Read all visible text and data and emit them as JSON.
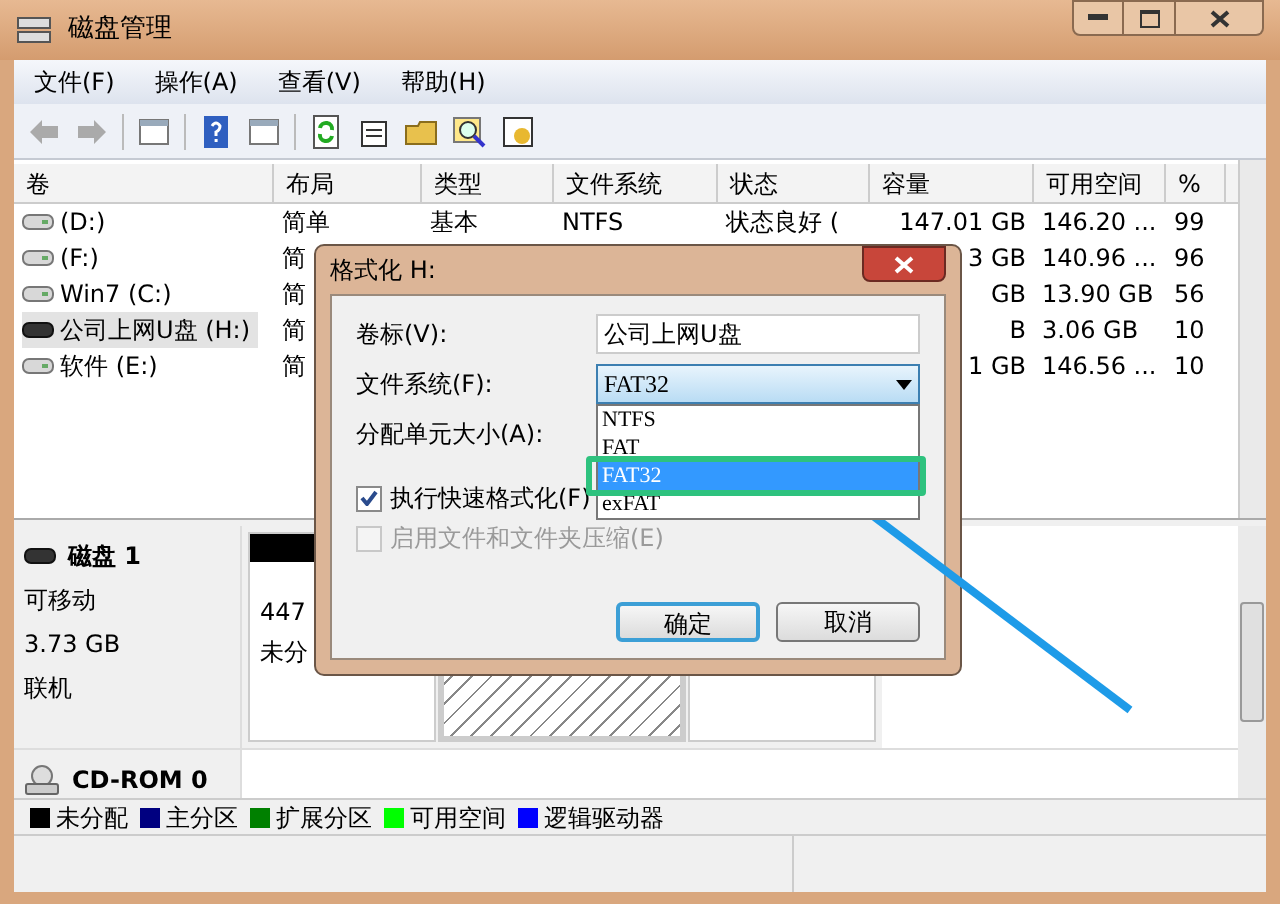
{
  "window": {
    "title": "磁盘管理"
  },
  "menu": [
    "文件(F)",
    "操作(A)",
    "查看(V)",
    "帮助(H)"
  ],
  "table": {
    "columns": [
      "卷",
      "布局",
      "类型",
      "文件系统",
      "状态",
      "容量",
      "可用空间",
      "%"
    ],
    "rows": [
      {
        "kind": "disk",
        "name": "(D:)",
        "layout": "简单",
        "type": "基本",
        "fs": "NTFS",
        "status": "状态良好 (",
        "capacity": "147.01 GB",
        "free": "146.20 ...",
        "pct": "99",
        "selected": false
      },
      {
        "kind": "disk",
        "name": "(F:)",
        "layout": "简",
        "capacity": "3 GB",
        "free": "140.96 ...",
        "pct": "96",
        "selected": false
      },
      {
        "kind": "disk",
        "name": "Win7 (C:)",
        "layout": "简",
        "capacity": "GB",
        "free": "13.90 GB",
        "pct": "56",
        "selected": false
      },
      {
        "kind": "removable",
        "name": "公司上网U盘 (H:)",
        "layout": "简",
        "capacity": "B",
        "free": "3.06 GB",
        "pct": "10",
        "selected": true
      },
      {
        "kind": "disk",
        "name": "软件 (E:)",
        "layout": "简",
        "capacity": "1 GB",
        "free": "146.56 ...",
        "pct": "10",
        "selected": false
      }
    ]
  },
  "disks": [
    {
      "kind": "removable",
      "name": "磁盘 1",
      "lines": [
        "可移动",
        "3.73 GB",
        "联机"
      ],
      "partitions": [
        {
          "kind": "unallocated",
          "lines": [
            "447",
            "未分"
          ]
        },
        {
          "kind": "hatched"
        },
        {
          "kind": "plain"
        }
      ]
    },
    {
      "kind": "cdrom",
      "name": "CD-ROM 0"
    }
  ],
  "legend": [
    {
      "label": "未分配",
      "color": "#000000"
    },
    {
      "label": "主分区",
      "color": "#000080"
    },
    {
      "label": "扩展分区",
      "color": "#008000"
    },
    {
      "label": "可用空间",
      "color": "#00ff00"
    },
    {
      "label": "逻辑驱动器",
      "color": "#0000ff"
    }
  ],
  "dialog": {
    "title": "格式化 H:",
    "volume_label": {
      "label": "卷标(V):",
      "value": "公司上网U盘"
    },
    "file_system": {
      "label": "文件系统(F):",
      "value": "FAT32",
      "expanded": true,
      "options": [
        {
          "label": "NTFS",
          "selected": false
        },
        {
          "label": "FAT",
          "selected": false
        },
        {
          "label": "FAT32",
          "selected": true
        },
        {
          "label": "exFAT",
          "selected": false
        }
      ]
    },
    "allocation": {
      "label": "分配单元大小(A):"
    },
    "checkboxes": [
      {
        "label": "执行快速格式化(F)",
        "checked": true,
        "disabled": false
      },
      {
        "label": "启用文件和文件夹压缩(E)",
        "checked": false,
        "disabled": true
      }
    ],
    "buttons": [
      {
        "label": "确定",
        "default": true
      },
      {
        "label": "取消",
        "default": false
      }
    ]
  }
}
